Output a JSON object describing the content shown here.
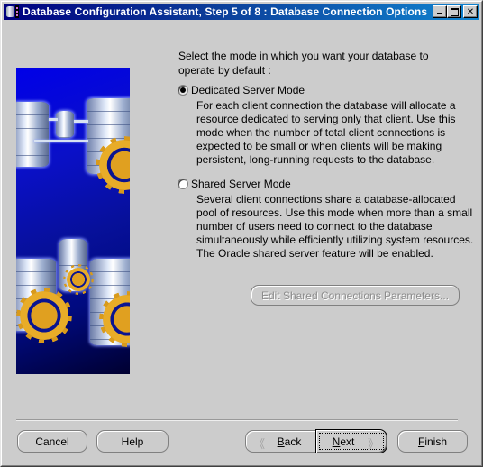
{
  "window": {
    "title": "Database Configuration Assistant, Step 5 of 8 : Database Connection Options",
    "controls": {
      "minimize": "minimize-icon",
      "maximize": "maximize-icon",
      "close_glyph": "✕"
    }
  },
  "content": {
    "intro": "Select the mode in which you want your database to operate by default :",
    "options": [
      {
        "label": "Dedicated Server Mode",
        "selected": true,
        "description": "For each client connection the database will allocate a resource dedicated to serving only that client.  Use this mode when the number of total client connections is expected to be small or when clients will be making persistent, long-running requests to the database."
      },
      {
        "label": "Shared Server Mode",
        "selected": false,
        "description": "Several client connections share a database-allocated pool of resources.  Use this mode when more than a small number of users need to connect to the database simultaneously while efficiently utilizing system resources.  The Oracle shared server feature will be enabled."
      }
    ],
    "edit_shared_button": "Edit Shared Connections Parameters...",
    "edit_shared_enabled": false
  },
  "footer": {
    "cancel": "Cancel",
    "help": "Help",
    "back_mnemonic": "B",
    "back_rest": "ack",
    "next_mnemonic": "N",
    "next_rest": "ext",
    "finish_mnemonic": "F",
    "finish_rest": "inish",
    "back_chevron": "《",
    "next_chevron": "》"
  }
}
